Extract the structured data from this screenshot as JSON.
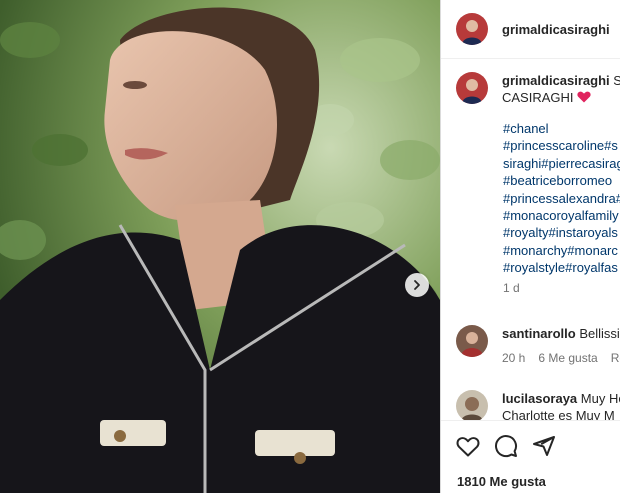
{
  "post": {
    "username": "grimaldicasiraghi",
    "caption_part1": "S",
    "caption_part2": "CASIRAGHI",
    "hashtags": [
      "#chanel",
      "#princesscaroline#s",
      "siraghi#pierrecasirag",
      "#beatriceborromeo",
      "#princessalexandra#",
      "#monacoroyalfamily",
      "#royalty#instaroyals",
      "#monarchy#monarc",
      "#royalstyle#royalfas"
    ],
    "time_ago": "1 d",
    "likes": "1810 Me gusta"
  },
  "comments": [
    {
      "username": "santinarollo",
      "text": "Bellissi",
      "time": "20 h",
      "likes": "6 Me gusta",
      "reply": "Re"
    },
    {
      "username": "lucilasoraya",
      "text": "Muy He",
      "text2": "Charlotte es Muy M"
    }
  ],
  "colors": {
    "heart": "#ed4956",
    "link": "#00376b",
    "meta": "#737373"
  },
  "icons": [
    "heart-icon",
    "comment-icon",
    "share-icon",
    "chevron-right-icon"
  ]
}
